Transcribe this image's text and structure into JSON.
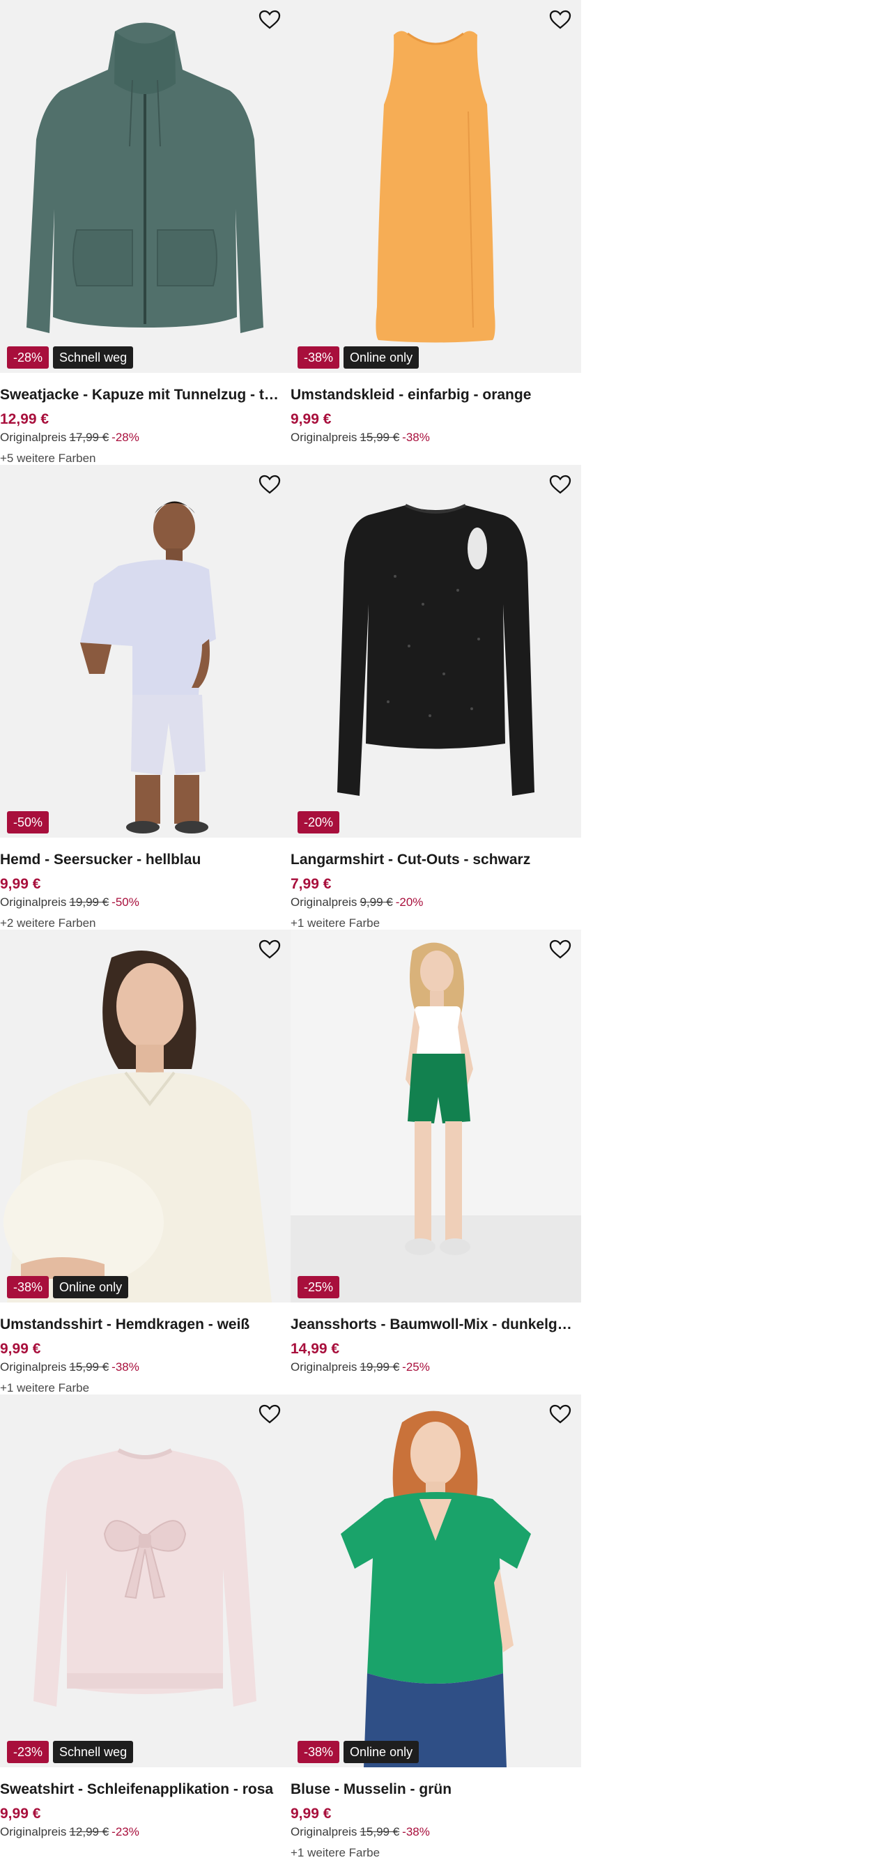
{
  "products": [
    {
      "title": "Sweatjacke - Kapuze mit Tunnelzug - türkis",
      "price": "12,99 €",
      "original_label": "Originalpreis",
      "original_price": "17,99 €",
      "discount": "-28%",
      "tag": "Schnell weg",
      "more_colors": "+5 weitere Farben",
      "garment": "hoodie-icon",
      "color": "#51706b"
    },
    {
      "title": "Umstandskleid - einfarbig - orange",
      "price": "9,99 €",
      "original_label": "Originalpreis",
      "original_price": "15,99 €",
      "discount": "-38%",
      "tag": "Online only",
      "more_colors": "",
      "garment": "dress-icon",
      "color": "#f6ad55"
    },
    {
      "title": "Hemd - Seersucker - hellblau",
      "price": "9,99 €",
      "original_label": "Originalpreis",
      "original_price": "19,99 €",
      "discount": "-50%",
      "tag": "",
      "more_colors": "+2 weitere Farben",
      "garment": "model-shirt-icon",
      "color": "#d8dbef"
    },
    {
      "title": "Langarmshirt - Cut-Outs - schwarz",
      "price": "7,99 €",
      "original_label": "Originalpreis",
      "original_price": "9,99 €",
      "discount": "-20%",
      "tag": "",
      "more_colors": "+1 weitere Farbe",
      "garment": "longsleeve-icon",
      "color": "#1b1b1b"
    },
    {
      "title": "Umstandsshirt - Hemdkragen - weiß",
      "price": "9,99 €",
      "original_label": "Originalpreis",
      "original_price": "15,99 €",
      "discount": "-38%",
      "tag": "Online only",
      "more_colors": "+1 weitere Farbe",
      "garment": "model-maternity-icon",
      "color": "#f3efe2"
    },
    {
      "title": "Jeansshorts - Baumwoll-Mix - dunkelgrün",
      "price": "14,99 €",
      "original_label": "Originalpreis",
      "original_price": "19,99 €",
      "discount": "-25%",
      "tag": "",
      "more_colors": "",
      "garment": "model-shorts-icon",
      "color": "#12814f"
    },
    {
      "title": "Sweatshirt - Schleifenapplikation - rosa",
      "price": "9,99 €",
      "original_label": "Originalpreis",
      "original_price": "12,99 €",
      "discount": "-23%",
      "tag": "Schnell weg",
      "more_colors": "",
      "garment": "sweatshirt-icon",
      "color": "#f1dfe0"
    },
    {
      "title": "Bluse - Musselin - grün",
      "price": "9,99 €",
      "original_label": "Originalpreis",
      "original_price": "15,99 €",
      "discount": "-38%",
      "tag": "Online only",
      "more_colors": "+1 weitere Farbe",
      "garment": "model-blouse-icon",
      "color": "#1aa36a"
    }
  ]
}
